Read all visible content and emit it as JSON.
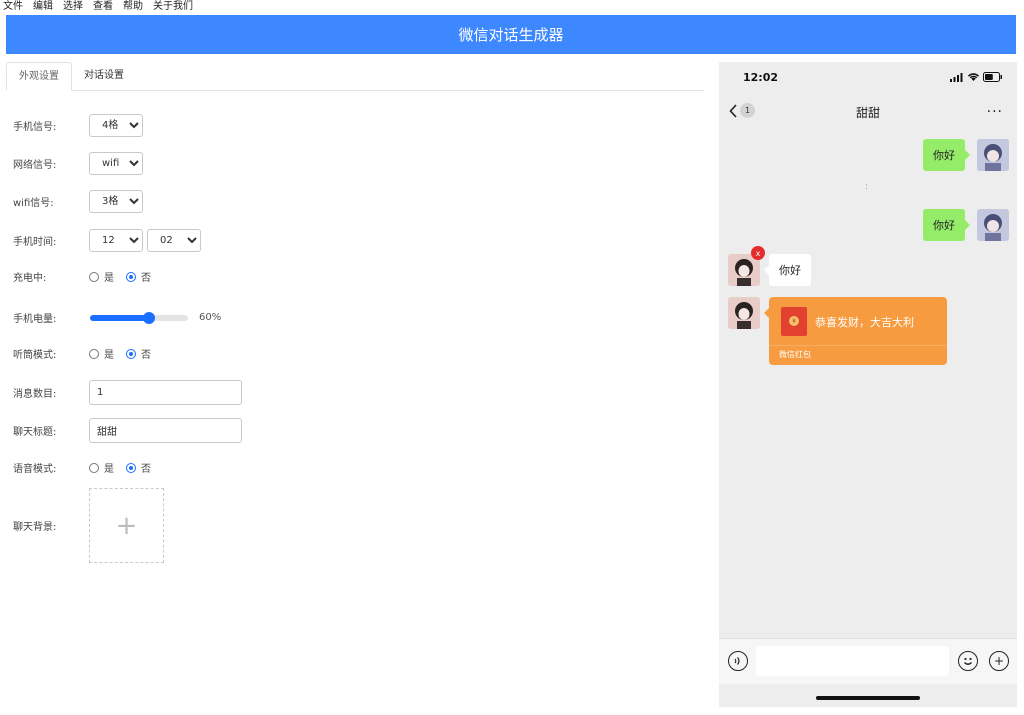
{
  "menu": [
    "文件",
    "编辑",
    "选择",
    "查看",
    "帮助",
    "关于我们"
  ],
  "app_title": "微信对话生成器",
  "tabs": [
    {
      "label": "外观设置",
      "active": true
    },
    {
      "label": "对话设置",
      "active": false
    }
  ],
  "settings": {
    "signal_label": "手机信号:",
    "signal_value": "4格",
    "network_label": "网络信号:",
    "network_value": "wifi",
    "wifi_label": "wifi信号:",
    "wifi_value": "3格",
    "time_label": "手机时间:",
    "time_hour": "12",
    "time_minute": "02",
    "charging_label": "充电中:",
    "yes": "是",
    "no": "否",
    "charging_selected": "否",
    "battery_label": "手机电量:",
    "battery_percent": 60,
    "battery_text": "60%",
    "earpiece_label": "听筒模式:",
    "earpiece_selected": "否",
    "msgcount_label": "消息数目:",
    "msgcount_value": "1",
    "chattitle_label": "聊天标题:",
    "chattitle_value": "甜甜",
    "voice_label": "语音模式:",
    "voice_selected": "否",
    "bg_label": "聊天背景:",
    "upload_plus": "+"
  },
  "phone": {
    "time": "12:02",
    "back_badge": "1",
    "chat_title": "甜甜",
    "more": "···",
    "msg1": "你好",
    "separator": ":",
    "msg2": "你好",
    "msg3": "你好",
    "red_x": "x",
    "redpacket_text": "恭喜发财，大吉大利",
    "redpacket_footer": "微信红包",
    "redpacket_coin": "¥",
    "plus": "+"
  },
  "colors": {
    "accent": "#3d88ff",
    "bubble_me": "#95ec69",
    "redpacket": "#f79b41"
  }
}
